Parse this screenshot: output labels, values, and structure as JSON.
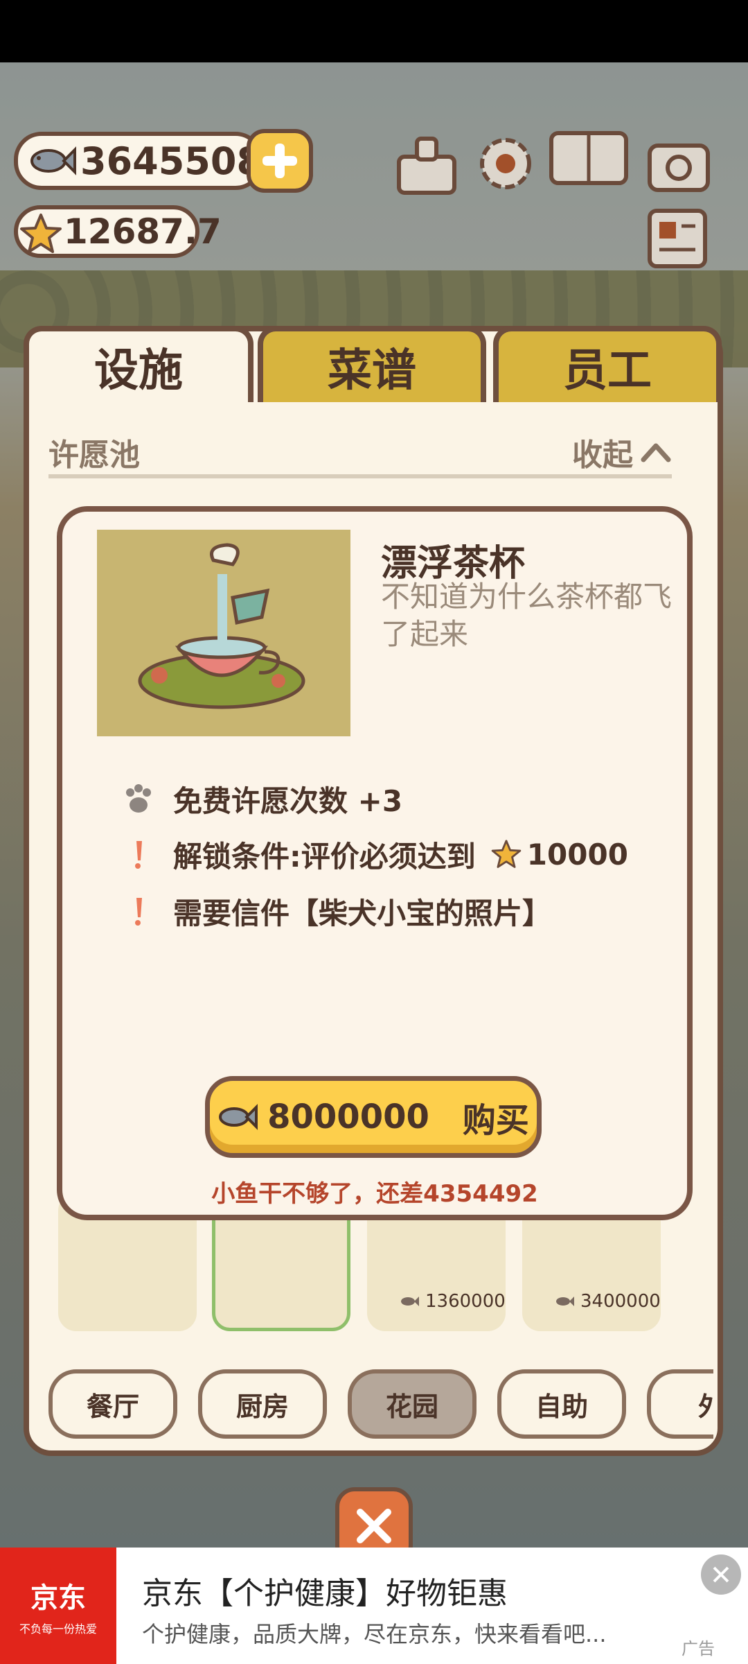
{
  "currency": {
    "fish": "3645508",
    "stars": "12687.7"
  },
  "tabs": [
    {
      "label": "设施",
      "active": true
    },
    {
      "label": "菜谱",
      "active": false
    },
    {
      "label": "员工",
      "active": false
    }
  ],
  "section": {
    "title": "许愿池",
    "collapse": "收起"
  },
  "dialog": {
    "title": "漂浮茶杯",
    "description": "不知道为什么茶杯都飞了起来",
    "effect": "免费许愿次数 +3",
    "unlock_condition": "解锁条件:评价必须达到",
    "unlock_value": "10000",
    "letter_requirement": "需要信件【柴犬小宝的照片】",
    "buy_price": "8000000",
    "buy_label": "购买",
    "warning": "小鱼干不够了，还差4354492"
  },
  "items": [
    {
      "price": ""
    },
    {
      "price": ""
    },
    {
      "price": "1360000"
    },
    {
      "price": "3400000"
    }
  ],
  "categories": [
    "餐厅",
    "厨房",
    "花园",
    "自助",
    "外"
  ],
  "selected_category": "花园",
  "ad": {
    "brand": "京东",
    "slogan": "不负每一份热爱",
    "title": "京东【个护健康】好物钜惠",
    "subtitle": "个护健康，品质大牌，尽在京东，快来看看吧...",
    "label": "广告"
  },
  "colors": {
    "panel_border": "#6e4f3e",
    "tab_gold": "#d7b43e",
    "buy_yellow": "#fdcf4c",
    "warning": "#b5452b",
    "ad_red": "#e1251b"
  }
}
